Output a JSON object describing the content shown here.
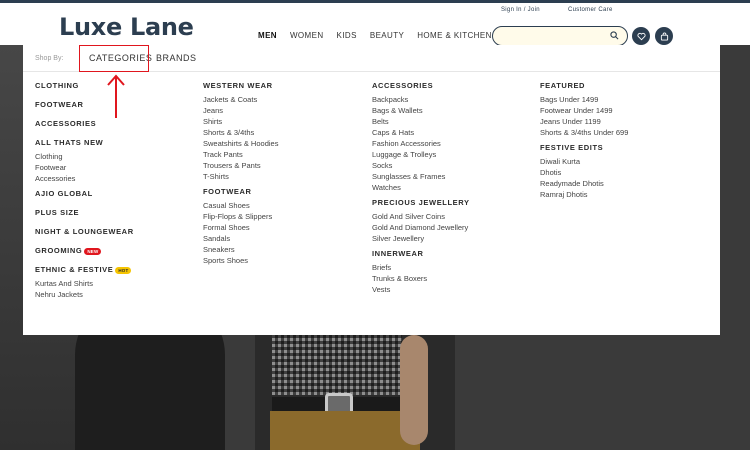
{
  "brand": {
    "name": "Luxe Lane"
  },
  "utility": {
    "signin": "Sign In / Join",
    "care": "Customer Care"
  },
  "nav": [
    "MEN",
    "WOMEN",
    "KIDS",
    "BEAUTY",
    "HOME & KITCHEN"
  ],
  "nav_active": "MEN",
  "search": {
    "value": "",
    "placeholder": ""
  },
  "icons": {
    "search": "search-icon",
    "wishlist": "heart-icon",
    "bag": "shopping-bag-icon"
  },
  "colors": {
    "brand": "#2c3e50",
    "highlight": "#e0161e",
    "hot": "#f5c400"
  },
  "menu": {
    "shop_by": "Shop By:",
    "tabs": {
      "categories": "CATEGORIES",
      "brands": "BRANDS"
    },
    "col1": {
      "clothing": "CLOTHING",
      "footwear": "FOOTWEAR",
      "accessories": "ACCESSORIES",
      "all_thats_new": "ALL THATS NEW",
      "atn_links": [
        "Clothing",
        "Footwear",
        "Accessories"
      ],
      "ajio_global": "AJIO GLOBAL",
      "plus_size": "PLUS SIZE",
      "night": "NIGHT & LOUNGEWEAR",
      "grooming": "GROOMING",
      "grooming_badge": "NEW",
      "ethnic": "ETHNIC & FESTIVE",
      "ethnic_badge": "HOT",
      "ethnic_links": [
        "Kurtas And Shirts",
        "Nehru Jackets"
      ]
    },
    "col2": {
      "western": "WESTERN WEAR",
      "western_links": [
        "Jackets & Coats",
        "Jeans",
        "Shirts",
        "Shorts & 3/4ths",
        "Sweatshirts & Hoodies",
        "Track Pants",
        "Trousers & Pants",
        "T-Shirts"
      ],
      "footwear": "FOOTWEAR",
      "footwear_links": [
        "Casual Shoes",
        "Flip-Flops & Slippers",
        "Formal Shoes",
        "Sandals",
        "Sneakers",
        "Sports Shoes"
      ]
    },
    "col3": {
      "accessories": "ACCESSORIES",
      "accessories_links": [
        "Backpacks",
        "Bags & Wallets",
        "Belts",
        "Caps & Hats",
        "Fashion Accessories",
        "Luggage & Trolleys",
        "Socks",
        "Sunglasses & Frames",
        "Watches"
      ],
      "precious": "PRECIOUS JEWELLERY",
      "precious_links": [
        "Gold And Silver Coins",
        "Gold And Diamond Jewellery",
        "Silver Jewellery"
      ],
      "innerwear": "INNERWEAR",
      "innerwear_links": [
        "Briefs",
        "Trunks & Boxers",
        "Vests"
      ]
    },
    "col4": {
      "featured": "FEATURED",
      "featured_links": [
        "Bags Under 1499",
        "Footwear Under 1499",
        "Jeans Under 1199",
        "Shorts & 3/4ths Under 699"
      ],
      "festive": "FESTIVE EDITS",
      "festive_links": [
        "Diwali Kurta",
        "Dhotis",
        "Readymade Dhotis",
        "Ramraj Dhotis"
      ]
    }
  }
}
